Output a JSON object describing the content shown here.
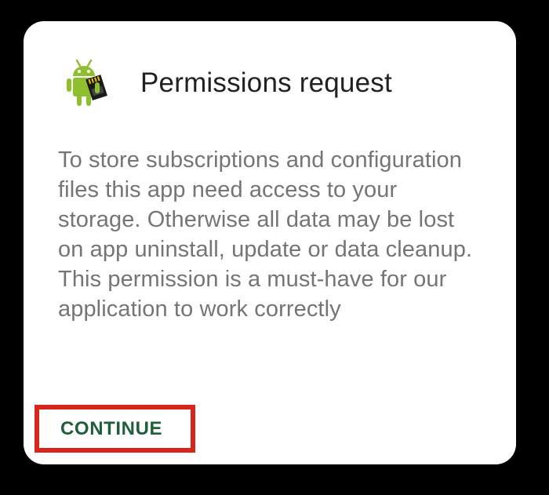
{
  "dialog": {
    "title": "Permissions request",
    "app_icon": "android-sdcard-icon",
    "message": "To store subscriptions and configuration files this app need access to your storage. Otherwise all data may be lost on app uninstall, update or data cleanup. This permission is a must-have for our application to work correctly",
    "continue_label": "CONTINUE"
  },
  "colors": {
    "background": "#000000",
    "dialog_background": "#ffffff",
    "title_text": "#212121",
    "message_text": "#757575",
    "button_text": "#1f5e3a",
    "highlight_border": "#d9261c",
    "android_green": "#8fbf2f"
  }
}
